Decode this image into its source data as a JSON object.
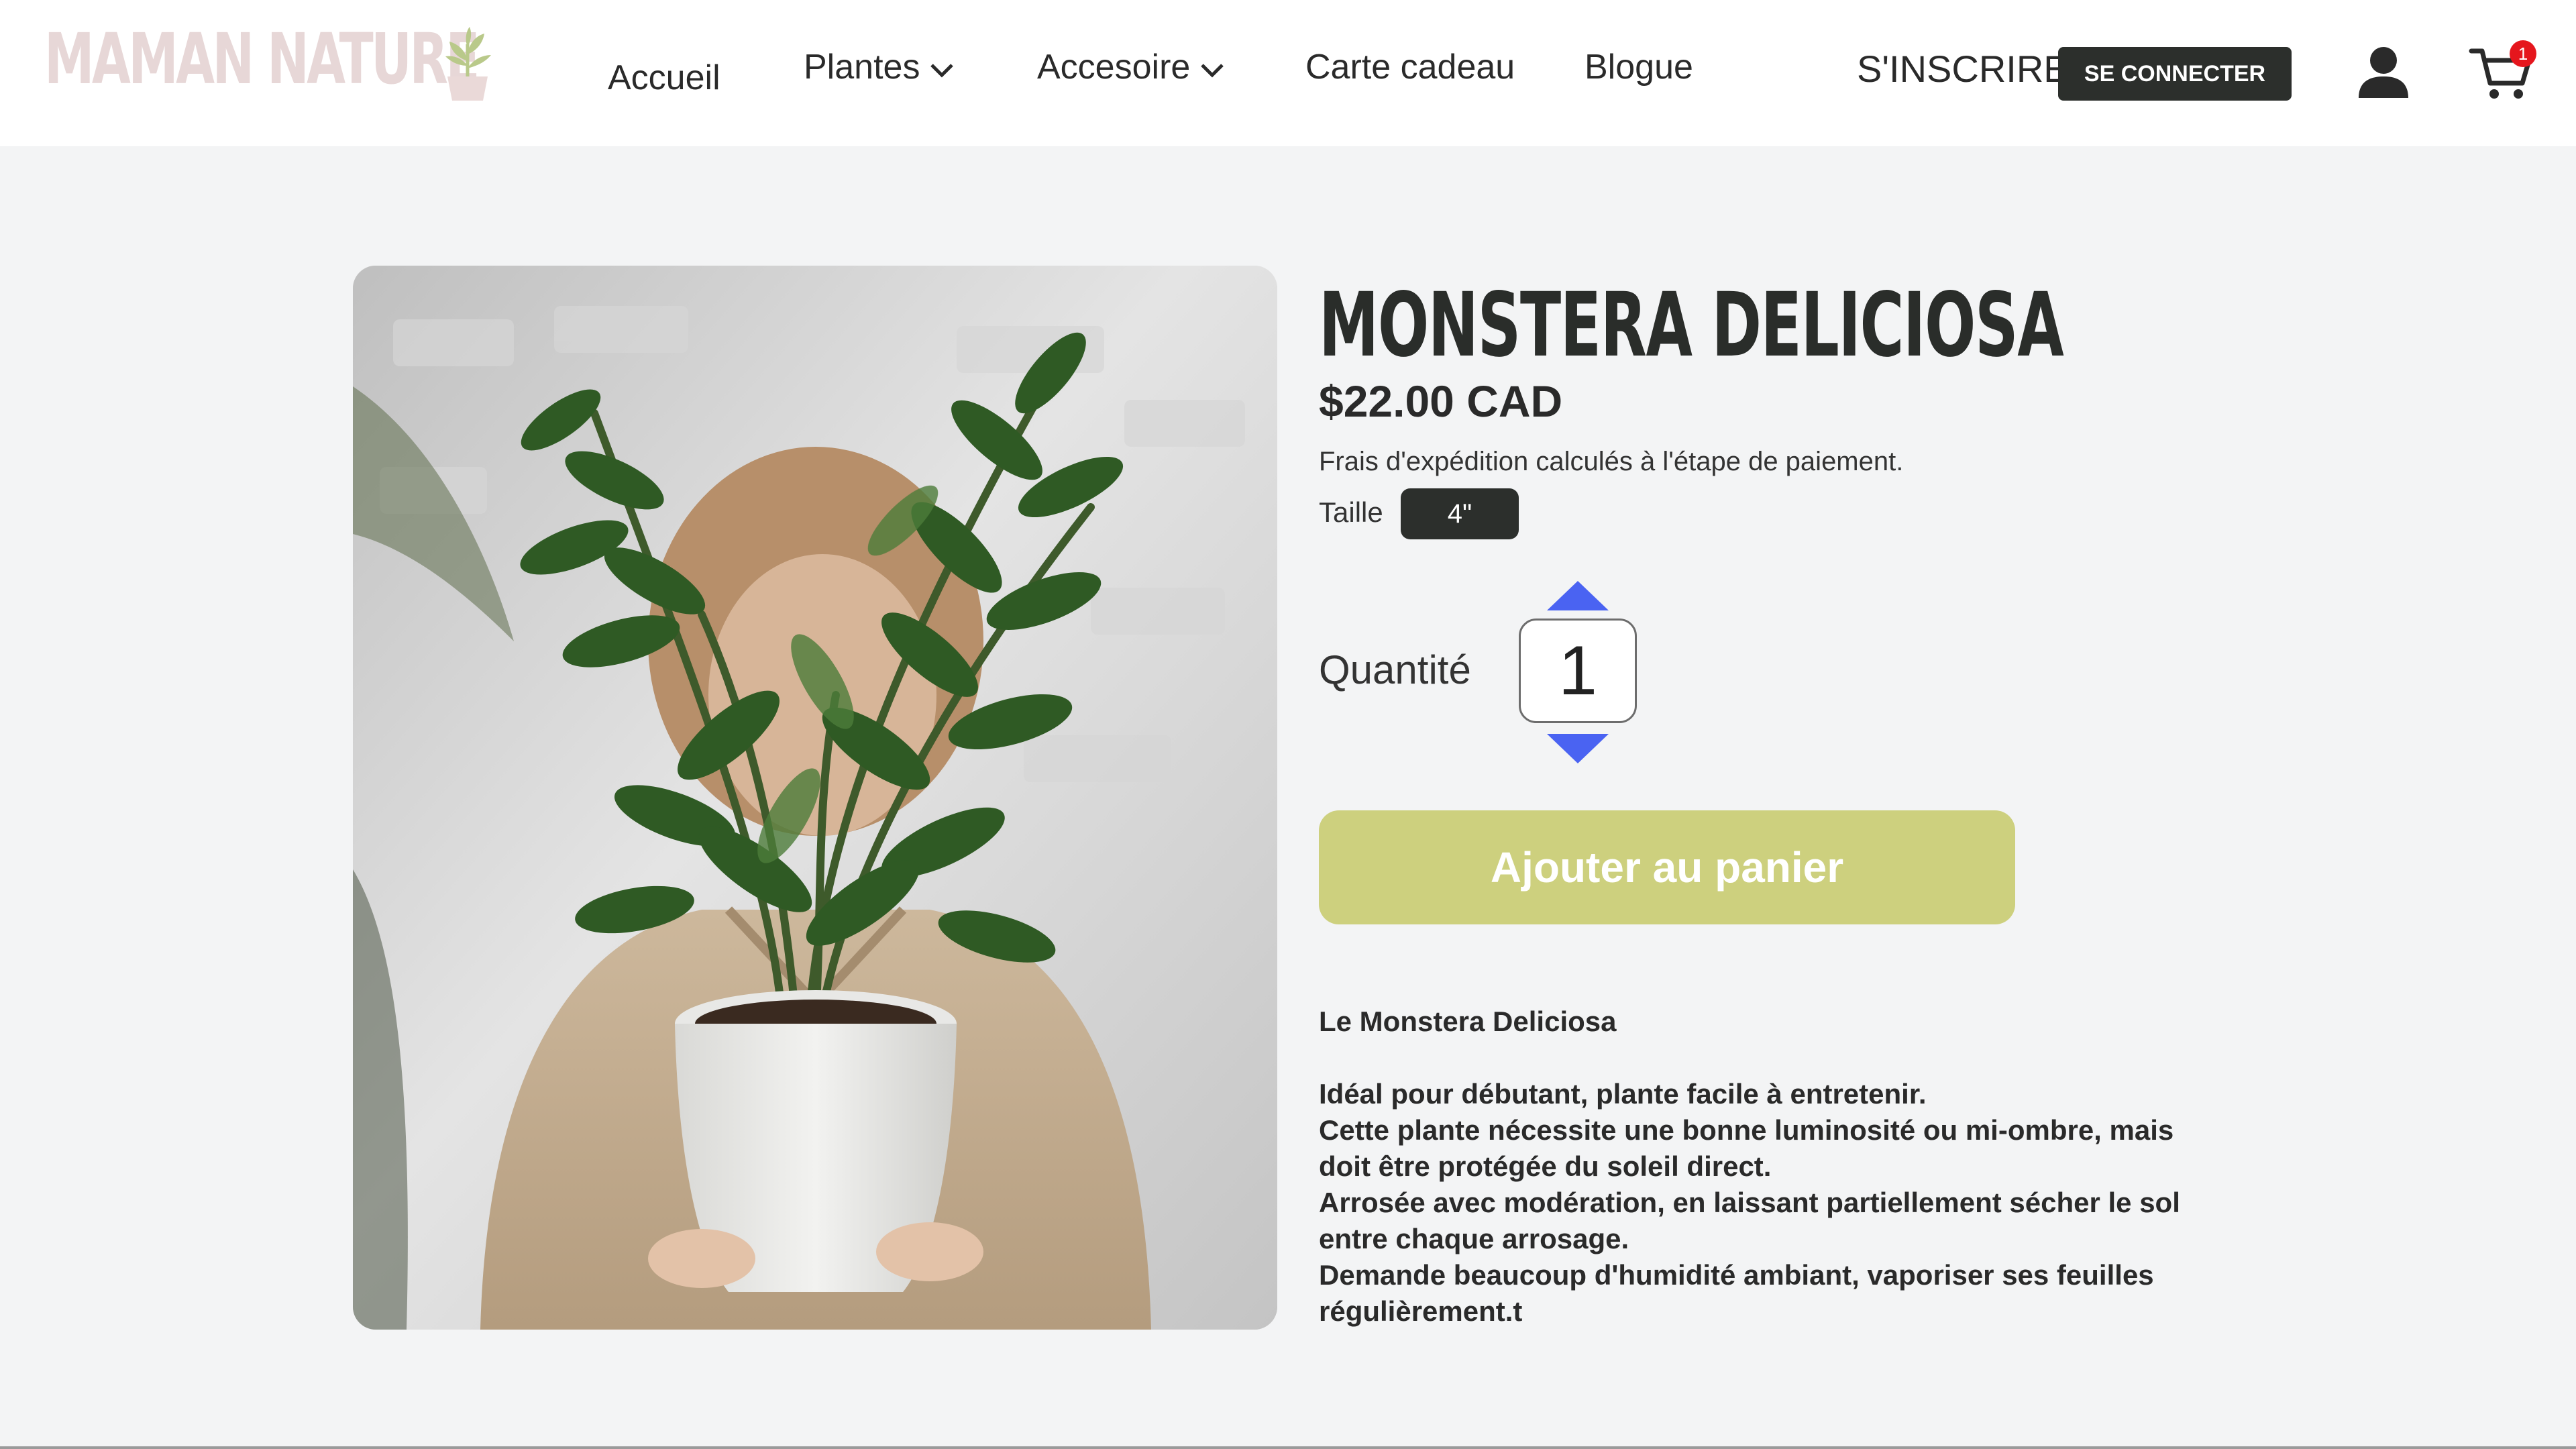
{
  "brand": {
    "name": "MAMAN NATURE"
  },
  "nav": {
    "items": [
      {
        "label": "Accueil",
        "dropdown": false
      },
      {
        "label": "Plantes",
        "dropdown": true
      },
      {
        "label": "Accesoire",
        "dropdown": true
      },
      {
        "label": "Carte cadeau",
        "dropdown": false
      },
      {
        "label": "Blogue",
        "dropdown": false
      }
    ],
    "signup_label": "S'INSCRIRE",
    "login_label": "SE CONNECTER",
    "cart_count": "1"
  },
  "product": {
    "title": "MONSTERA DELICIOSA",
    "price": "$22.00 CAD",
    "shipping_note": "Frais d'expédition calculés à l'étape de paiement.",
    "size_label": "Taille",
    "size_value": "4\"",
    "quantity_label": "Quantité",
    "quantity_value": "1",
    "add_to_cart_label": "Ajouter au panier",
    "description_heading": "Le Monstera Deliciosa",
    "description_lines": [
      "Idéal pour débutant, plante facile à entretenir.",
      "Cette plante nécessite une bonne luminosité ou mi-ombre, mais doit être protégée du soleil direct.",
      "Arrosée avec modération, en laissant partiellement sécher le sol entre chaque arrosage.",
      "Demande beaucoup d'humidité ambiant, vaporiser ses feuilles régulièrement.t"
    ]
  },
  "icons": {
    "logo": "potted-plant-icon",
    "nav_dropdown": "chevron-down-icon",
    "user": "user-icon",
    "cart": "shopping-cart-icon",
    "qty_up": "triangle-up-icon",
    "qty_down": "triangle-down-icon"
  },
  "colors": {
    "header_bg": "#ffffff",
    "page_bg": "#f3f4f5",
    "logo": "#e7d7d7",
    "logo_leaf": "#b9c98a",
    "dark_button": "#2c2f2c",
    "add_button": "#cdd07e",
    "stepper_arrow": "#4a63f2",
    "badge": "#e5161d"
  }
}
